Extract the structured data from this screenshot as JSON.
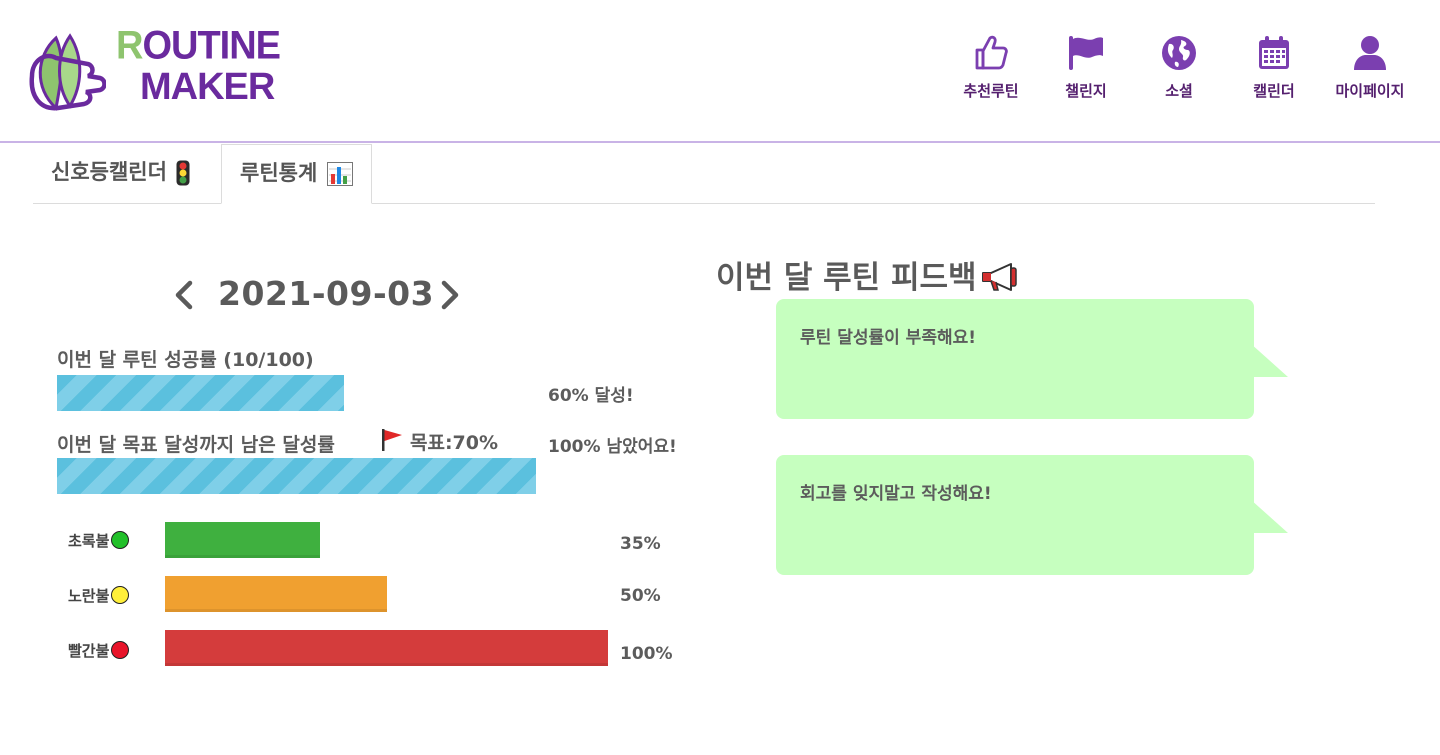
{
  "app": {
    "logo_line1_initial": "R",
    "logo_line1_rest": "OUTINE",
    "logo_line2": "MAKER"
  },
  "nav": [
    {
      "label": "추천루틴",
      "icon": "thumbs-up-icon"
    },
    {
      "label": "챌린지",
      "icon": "flag-icon"
    },
    {
      "label": "소셜",
      "icon": "globe-icon"
    },
    {
      "label": "캘린더",
      "icon": "calendar-icon"
    },
    {
      "label": "마이페이지",
      "icon": "user-icon"
    }
  ],
  "tabs": [
    {
      "label": "신호등캘린더",
      "icon": "traffic-light-icon",
      "active": false
    },
    {
      "label": "루틴통계",
      "icon": "bar-chart-icon",
      "active": true
    }
  ],
  "stats": {
    "date": "2021-09-03",
    "success_label": "이번 달 루틴 성공률  (10/100)",
    "success_side": "60% 달성!",
    "success_fill": 0.6,
    "remaining_label": "이번 달 목표 달성까지 남은 달성률",
    "goal_label": "목표:70%",
    "remaining_side": "100% 남았어요!",
    "remaining_fill": 1.0
  },
  "lights": [
    {
      "label": "초록불",
      "color": "#3fb03f",
      "pct_text": "35%",
      "fill": 0.35
    },
    {
      "label": "노란불",
      "color": "#f0a030",
      "pct_text": "50%",
      "fill": 0.5
    },
    {
      "label": "빨간불",
      "color": "#d43c3c",
      "pct_text": "100%",
      "fill": 1.0
    }
  ],
  "feedback": {
    "title": "이번 달 루틴 피드백",
    "messages": [
      "루틴 달성률이 부족해요!",
      "회고를 잊지말고 작성해요!"
    ]
  },
  "colors": {
    "brand_purple": "#6a2a9e",
    "brand_green": "#8ec46e",
    "bubble_green": "#c6ffbf",
    "progress_blue": "#5bc0de"
  }
}
